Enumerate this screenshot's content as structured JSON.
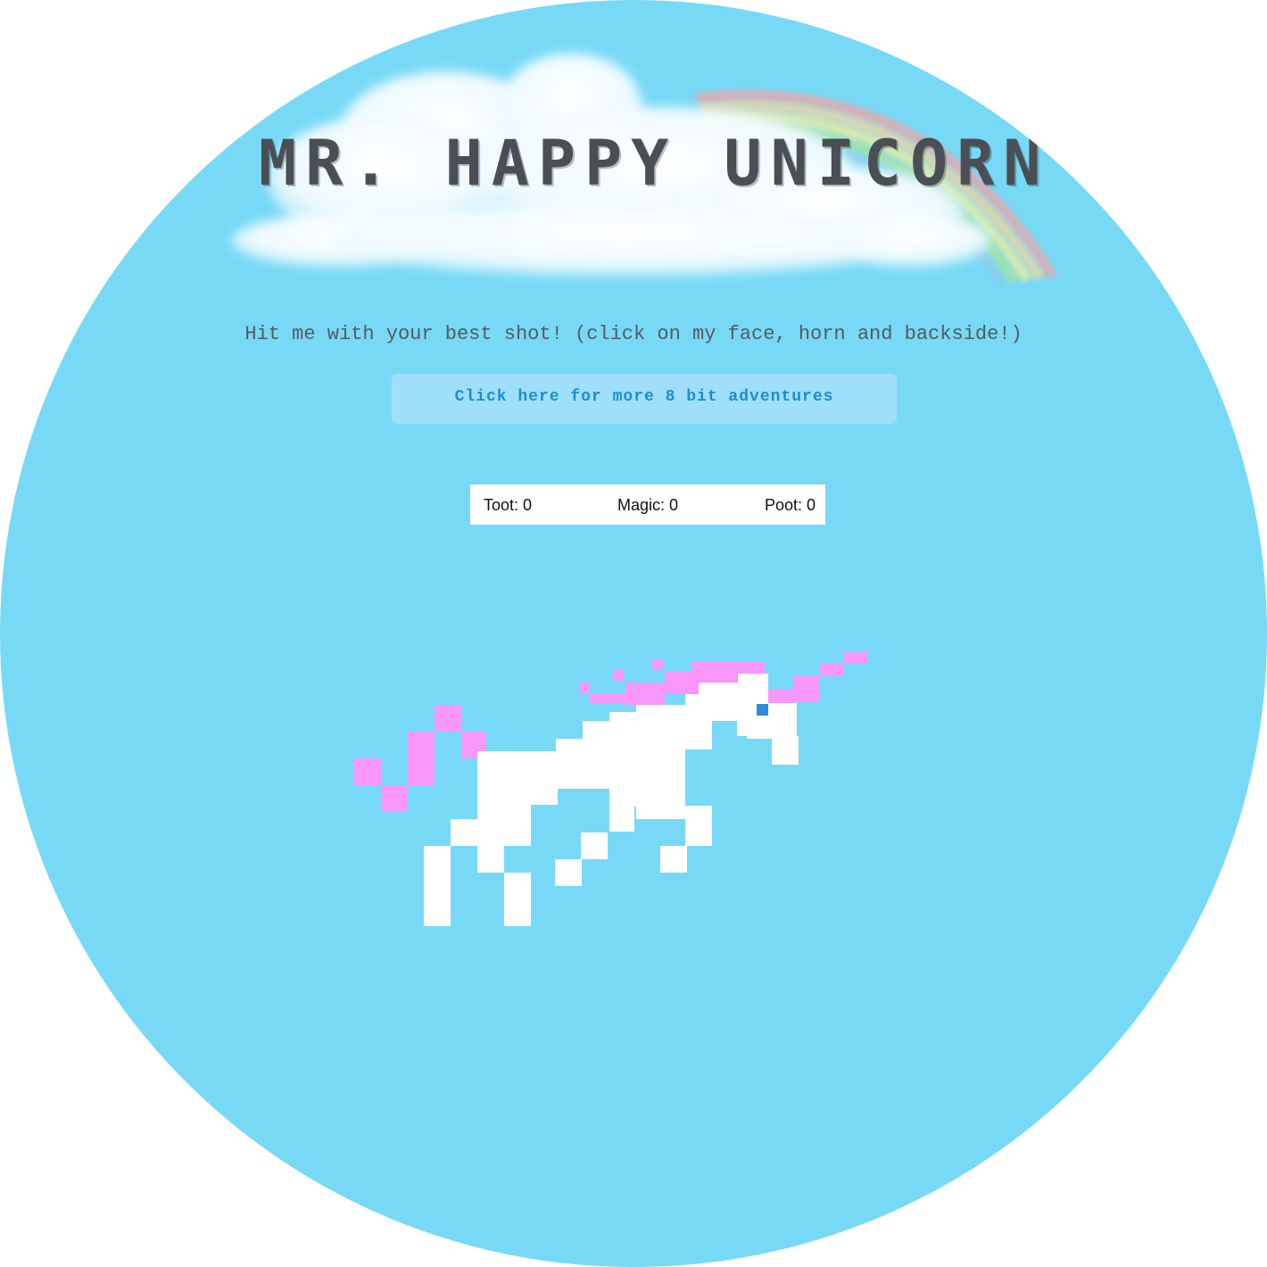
{
  "app": {
    "title": "MR. HAPPY UNICORN"
  },
  "tagline": "Hit me with your best shot! (click on my face, horn and backside!)",
  "adventure_button": {
    "label": "Click here for more 8 bit adventures"
  },
  "scores": {
    "toot_label": "Toot: 0",
    "magic_label": "Magic: 0",
    "poot_label": "Poot: 0"
  },
  "colors": {
    "sky": "#77d9f6",
    "unicorn_body": "#ffffff",
    "mane": "#f896f9",
    "eye": "#2c8dd6",
    "button_bg": "#9fdffc",
    "button_text": "#1a8fcf",
    "title_text": "#4a4f55"
  },
  "icons": {
    "banner": "cloud-rainbow-illustration",
    "sprite": "pixel-unicorn"
  }
}
